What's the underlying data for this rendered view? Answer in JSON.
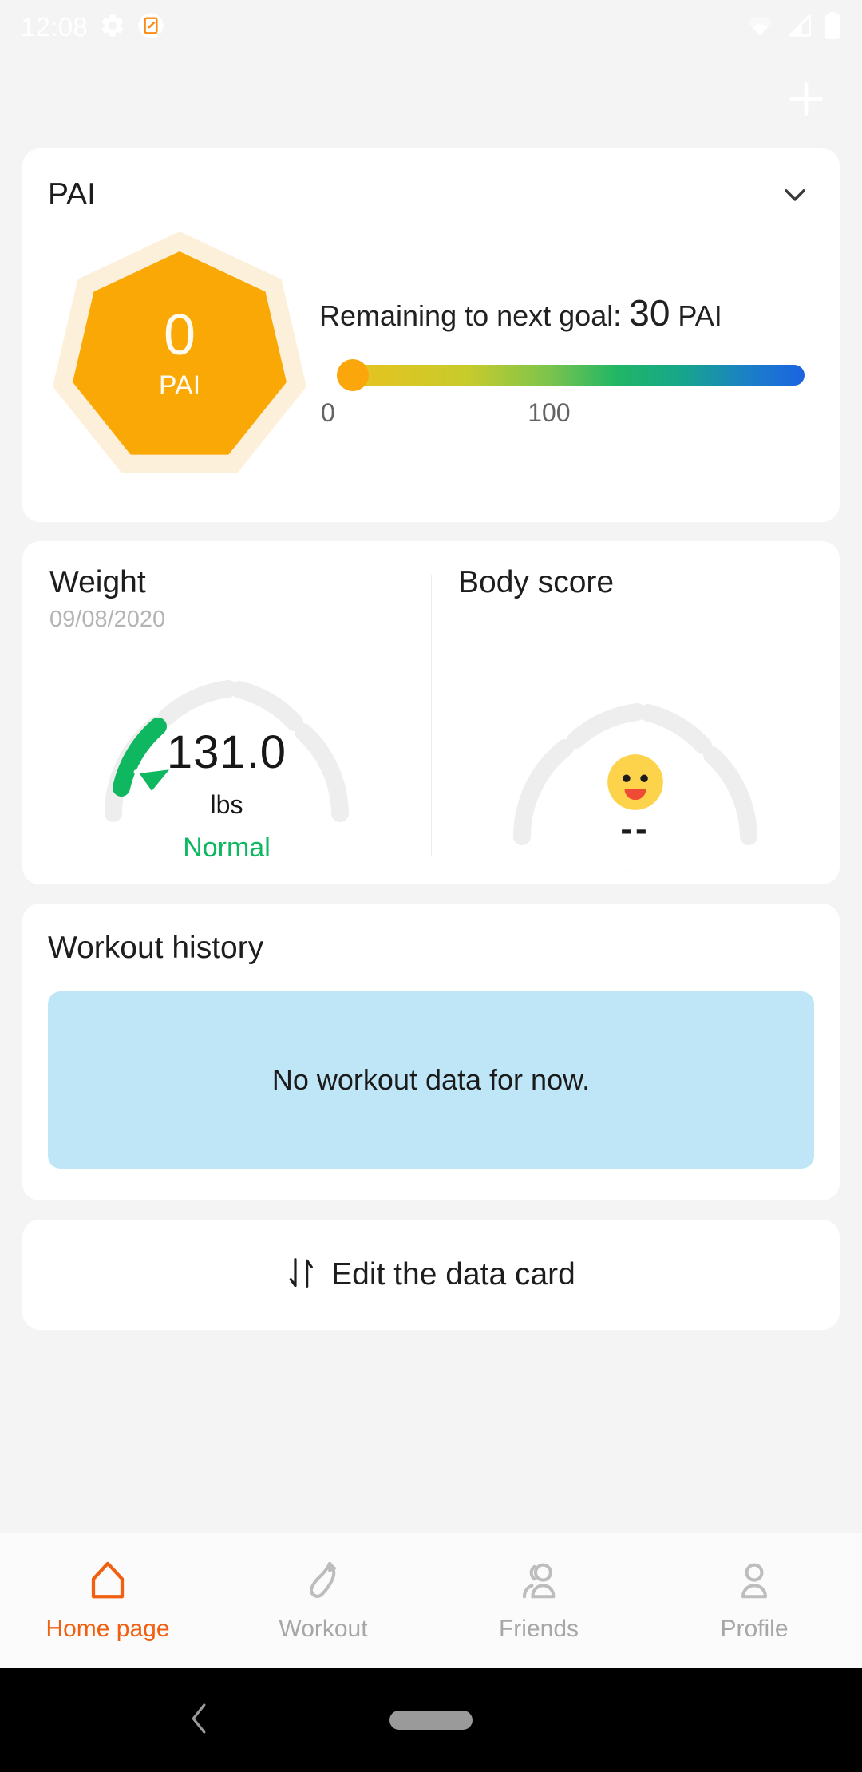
{
  "status_bar": {
    "time": "12:08",
    "icons": [
      "gear-icon",
      "screenshot-icon",
      "wifi-icon",
      "cellular-signal-icon",
      "battery-icon"
    ]
  },
  "header": {
    "add_button_label": "+"
  },
  "pai_card": {
    "title": "PAI",
    "collapse_icon": "chevron-down-icon",
    "badge_value": "0",
    "badge_unit": "PAI",
    "goal_text_prefix": "Remaining to next goal: ",
    "goal_value": "30",
    "goal_text_suffix": "PAI",
    "scale_min": "0",
    "scale_max": "100",
    "progress_value": 0,
    "colors": {
      "badge_fill": "#f9a806",
      "badge_halo": "#fdf0da",
      "knob": "#fba60a"
    }
  },
  "metrics_card": {
    "weight": {
      "title": "Weight",
      "date": "09/08/2020",
      "value": "131.0",
      "unit": "lbs",
      "status": "Normal",
      "status_color": "#0fb760",
      "gauge_fill_fraction": 0.22
    },
    "body_score": {
      "title": "Body score",
      "emoji": "slightly-smiling-face-icon",
      "value": "--",
      "sub_value": "--",
      "gauge_fill_fraction": 0
    }
  },
  "workout_history": {
    "title": "Workout history",
    "empty_message": "No workout data for now.",
    "empty_bg": "#bfe6f7"
  },
  "edit_card": {
    "icon": "sort-arrows-icon",
    "label": "Edit the data card"
  },
  "bottom_nav": {
    "active_color": "#f06010",
    "inactive_color": "#a7a7a7",
    "items": [
      {
        "label": "Home page",
        "icon": "home-icon",
        "active": true
      },
      {
        "label": "Workout",
        "icon": "shoe-icon",
        "active": false
      },
      {
        "label": "Friends",
        "icon": "people-icon",
        "active": false
      },
      {
        "label": "Profile",
        "icon": "person-icon",
        "active": false
      }
    ]
  },
  "system_nav": {
    "back_icon": "back-chevron-icon",
    "home_pill": "gesture-pill"
  }
}
